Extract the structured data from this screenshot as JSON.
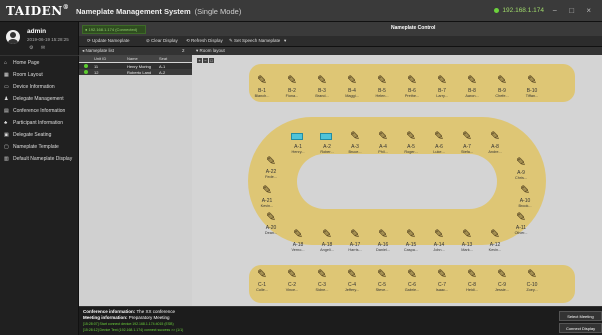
{
  "header": {
    "logo": "TAIDEN",
    "logo_mark": "®",
    "title": "Nameplate Management System",
    "mode": "(Single Mode)",
    "ip": "192.168.1.174",
    "window_controls": "− □ ×"
  },
  "user": {
    "name": "admin",
    "datetime": "2019-06-19 15:28:25",
    "icons": "⚙ ✉"
  },
  "sidebar": {
    "items": [
      {
        "label": "Home Page",
        "icon": "⌂"
      },
      {
        "label": "Room Layout",
        "icon": "▦"
      },
      {
        "label": "Device Information",
        "icon": "▭"
      },
      {
        "label": "Delegate Management",
        "icon": "♟"
      },
      {
        "label": "Conference Information",
        "icon": "▤"
      },
      {
        "label": "Participant Information",
        "icon": "♣"
      },
      {
        "label": "Delegate Seating",
        "icon": "▣"
      },
      {
        "label": "Nameplate Template",
        "icon": "▢"
      },
      {
        "label": "Default Nameplate Display",
        "icon": "▥"
      }
    ]
  },
  "status": {
    "connected": "● 192.168.1.174 (Connected)",
    "conference_title": "Nameplate Control"
  },
  "toolbar": {
    "update": "⟳ Update Nameplate",
    "clear": "⊘ Clear Display",
    "refresh": "⟲ Refresh Display",
    "set_speech": "✎ Set Speech Nameplate",
    "more": "▾"
  },
  "list": {
    "tab": "◂ Nameplate list",
    "count": "2",
    "headers": [
      "Unit ID",
      "Name",
      "Seat"
    ],
    "rows": [
      {
        "id": "11",
        "name": "Henry Moring",
        "seat": "A-1"
      },
      {
        "id": "12",
        "name": "Roberto Land",
        "seat": "A-2"
      }
    ]
  },
  "seat_layout": {
    "tab": "▾ Room layout",
    "zoom": [
      "+",
      "−",
      "□"
    ]
  },
  "seats": [
    {
      "id": "B-1",
      "name": "Blanch..."
    },
    {
      "id": "B-2",
      "name": "Fiona..."
    },
    {
      "id": "B-3",
      "name": "Brand..."
    },
    {
      "id": "B-4",
      "name": "Maggi..."
    },
    {
      "id": "B-5",
      "name": "Helen..."
    },
    {
      "id": "B-6",
      "name": "Prethe..."
    },
    {
      "id": "B-7",
      "name": "Larry..."
    },
    {
      "id": "B-8",
      "name": "Aaron..."
    },
    {
      "id": "B-9",
      "name": "Chefe..."
    },
    {
      "id": "B-10",
      "name": "Tiffan..."
    },
    {
      "id": "A-1",
      "name": "Henry..."
    },
    {
      "id": "A-2",
      "name": "Rober..."
    },
    {
      "id": "A-3",
      "name": "Bruce..."
    },
    {
      "id": "A-4",
      "name": "Phil..."
    },
    {
      "id": "A-5",
      "name": "Roger..."
    },
    {
      "id": "A-6",
      "name": "Luke..."
    },
    {
      "id": "A-7",
      "name": "Stefa..."
    },
    {
      "id": "A-8",
      "name": "Andre..."
    },
    {
      "id": "A-9",
      "name": "Chris..."
    },
    {
      "id": "A-10",
      "name": "Brook..."
    },
    {
      "id": "A-11",
      "name": "Oliver..."
    },
    {
      "id": "A-22",
      "name": "Fede..."
    },
    {
      "id": "A-21",
      "name": "Kevin..."
    },
    {
      "id": "A-20",
      "name": "Dean..."
    },
    {
      "id": "A-18",
      "name": "Verno..."
    },
    {
      "id": "A-18",
      "name": "Angeli..."
    },
    {
      "id": "A-17",
      "name": "Harris..."
    },
    {
      "id": "A-16",
      "name": "Daniel..."
    },
    {
      "id": "A-15",
      "name": "Caspa..."
    },
    {
      "id": "A-14",
      "name": "John..."
    },
    {
      "id": "A-13",
      "name": "Mark..."
    },
    {
      "id": "A-12",
      "name": "Kevin..."
    },
    {
      "id": "C-1",
      "name": "Colle..."
    },
    {
      "id": "C-2",
      "name": "Vince..."
    },
    {
      "id": "C-3",
      "name": "Sidne..."
    },
    {
      "id": "C-4",
      "name": "Jeffery..."
    },
    {
      "id": "C-5",
      "name": "Steve..."
    },
    {
      "id": "C-6",
      "name": "Gabrie..."
    },
    {
      "id": "C-7",
      "name": "Isaac..."
    },
    {
      "id": "C-8",
      "name": "Heidi..."
    },
    {
      "id": "C-9",
      "name": "Jessie..."
    },
    {
      "id": "C-10",
      "name": "Zoey..."
    }
  ],
  "meeting": {
    "conf_label": "Conference information:",
    "conf_value": "The XX conference",
    "meet_label": "Meeting information:",
    "meet_value": "Preparatory Meeting"
  },
  "log": {
    "line1": "[15:28:07] Start connect device:192.168.1.174:4015 (ESB)",
    "line2": "[15:28:12] Device Text (192.168.1.174) connect success >> (1/1)"
  },
  "actions": {
    "select_meeting": "Select Meeting",
    "connect_display": "Connect Display"
  }
}
